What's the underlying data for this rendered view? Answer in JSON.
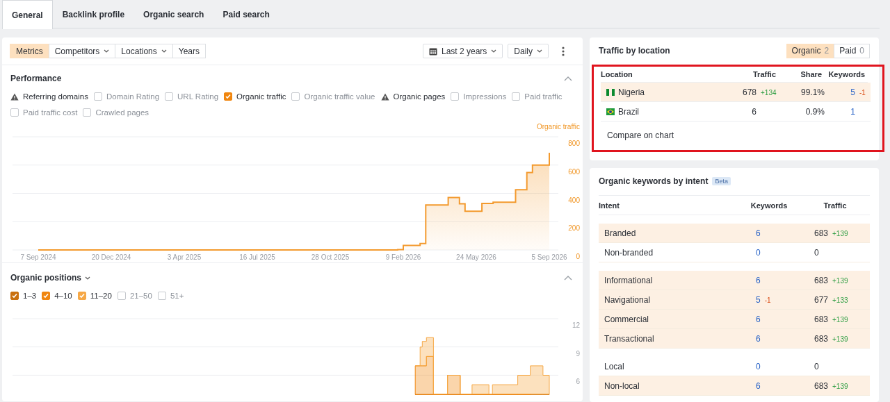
{
  "tabs": [
    {
      "label": "General",
      "selected": true
    },
    {
      "label": "Backlink profile",
      "selected": false
    },
    {
      "label": "Organic search",
      "selected": false
    },
    {
      "label": "Paid search",
      "selected": false
    }
  ],
  "toolbar": {
    "view_buttons": [
      {
        "label": "Metrics",
        "selected": true,
        "dropdown": false
      },
      {
        "label": "Competitors",
        "selected": false,
        "dropdown": true
      },
      {
        "label": "Locations",
        "selected": false,
        "dropdown": true
      },
      {
        "label": "Years",
        "selected": false,
        "dropdown": false
      }
    ],
    "date_range": "Last 2 years",
    "interval": "Daily"
  },
  "performance": {
    "title": "Performance",
    "expanded": true,
    "metrics": [
      {
        "label": "Referring domains",
        "kind": "warning"
      },
      {
        "label": "Domain Rating",
        "kind": "checkbox",
        "checked": false
      },
      {
        "label": "URL Rating",
        "kind": "checkbox",
        "checked": false
      },
      {
        "label": "Organic traffic",
        "kind": "checkbox",
        "checked": true
      },
      {
        "label": "Organic traffic value",
        "kind": "checkbox",
        "checked": false
      },
      {
        "label": "Organic pages",
        "kind": "warning"
      },
      {
        "label": "Impressions",
        "kind": "checkbox",
        "checked": false
      },
      {
        "label": "Paid traffic",
        "kind": "checkbox",
        "checked": false
      },
      {
        "label": "Paid traffic cost",
        "kind": "checkbox",
        "checked": false
      },
      {
        "label": "Crawled pages",
        "kind": "checkbox",
        "checked": false
      }
    ],
    "chart_data": {
      "type": "area",
      "grid": true,
      "ylim": [
        0,
        800
      ],
      "yticks": [
        0,
        200,
        400,
        600,
        800
      ],
      "categories": [
        "7 Sep 2024",
        null,
        null,
        null,
        null,
        null,
        null,
        null,
        null,
        null,
        null,
        null,
        null,
        "20 Dec 2024",
        null,
        null,
        null,
        null,
        null,
        null,
        null,
        null,
        null,
        null,
        null,
        null,
        "3 Apr 2025",
        null,
        null,
        null,
        null,
        null,
        null,
        null,
        null,
        null,
        null,
        null,
        null,
        "16 Jul 2025",
        null,
        null,
        null,
        null,
        null,
        null,
        null,
        null,
        null,
        null,
        null,
        null,
        "28 Oct 2025",
        null,
        null,
        null,
        null,
        null,
        null,
        null,
        null,
        null,
        null,
        null,
        null,
        "9 Feb 2026",
        null,
        null,
        null,
        null,
        null,
        null,
        null,
        null,
        null,
        null,
        null,
        null,
        "24 May 2026",
        null,
        null,
        null,
        null,
        null,
        null,
        null,
        null,
        null,
        null,
        null,
        null,
        "5 Sep 2026"
      ],
      "series": [
        {
          "name": "Organic traffic",
          "color": "#f39a2e",
          "values": [
            0,
            0,
            0,
            0,
            0,
            0,
            0,
            0,
            0,
            0,
            0,
            0,
            0,
            0,
            0,
            0,
            0,
            0,
            0,
            0,
            0,
            0,
            0,
            0,
            0,
            0,
            0,
            0,
            0,
            0,
            0,
            0,
            0,
            0,
            0,
            0,
            0,
            0,
            0,
            0,
            0,
            0,
            0,
            0,
            0,
            0,
            0,
            0,
            0,
            0,
            0,
            0,
            0,
            0,
            0,
            0,
            0,
            0,
            0,
            0,
            0,
            0,
            0,
            0,
            2,
            32,
            32,
            32,
            45,
            318,
            318,
            318,
            318,
            371,
            371,
            326,
            274,
            274,
            274,
            329,
            329,
            337,
            337,
            337,
            337,
            426,
            426,
            547,
            600,
            600,
            600,
            687
          ]
        }
      ]
    }
  },
  "organic_positions": {
    "title": "Organic positions",
    "expanded": true,
    "ranges": [
      {
        "label": "1–3",
        "checked": true,
        "color": "#c9700e"
      },
      {
        "label": "4–10",
        "checked": true,
        "color": "#f0860f"
      },
      {
        "label": "11–20",
        "checked": true,
        "color": "#f6a846"
      },
      {
        "label": "21–50",
        "checked": false
      },
      {
        "label": "51+",
        "checked": false
      }
    ],
    "y_axis_labels": [
      "12",
      "9",
      "6"
    ]
  },
  "traffic_by_location": {
    "title": "Traffic by location",
    "highlighted": true,
    "toggle": [
      {
        "label": "Organic",
        "count": "2",
        "selected": true
      },
      {
        "label": "Paid",
        "count": "0",
        "selected": false
      }
    ],
    "columns": [
      "Location",
      "Traffic",
      "Share",
      "Keywords"
    ],
    "rows": [
      {
        "kind": "nigeria",
        "name": "Nigeria",
        "traffic": "678",
        "traffic_delta": {
          "text": "+134",
          "kind": "increase"
        },
        "share": "99.1%",
        "keywords": "5",
        "keywords_delta": {
          "text": "-1",
          "kind": "decrease"
        },
        "highlighted": true
      },
      {
        "kind": "brazil",
        "name": "Brazil",
        "traffic": "6",
        "share": "0.9%",
        "keywords": "1",
        "highlighted": false
      }
    ],
    "compare_link": "Compare on chart"
  },
  "keywords_by_intent": {
    "title": "Organic keywords by intent",
    "badge": "Beta",
    "columns": [
      "Intent",
      "Keywords",
      "Traffic"
    ],
    "groups": [
      {
        "rows": [
          {
            "label": "Branded",
            "keywords": "6",
            "traffic": "683",
            "traffic_delta": {
              "text": "+139",
              "kind": "increase"
            },
            "highlighted": true
          },
          {
            "label": "Non-branded",
            "keywords": "0",
            "traffic": "0",
            "highlighted": false
          }
        ]
      },
      {
        "rows": [
          {
            "label": "Informational",
            "keywords": "6",
            "traffic": "683",
            "traffic_delta": {
              "text": "+139",
              "kind": "increase"
            },
            "highlighted": true
          },
          {
            "label": "Navigational",
            "keywords": "5",
            "keywords_delta": {
              "text": "-1",
              "kind": "decrease"
            },
            "traffic": "677",
            "traffic_delta": {
              "text": "+133",
              "kind": "increase"
            },
            "highlighted": true
          },
          {
            "label": "Commercial",
            "keywords": "6",
            "traffic": "683",
            "traffic_delta": {
              "text": "+139",
              "kind": "increase"
            },
            "highlighted": true
          },
          {
            "label": "Transactional",
            "keywords": "6",
            "traffic": "683",
            "traffic_delta": {
              "text": "+139",
              "kind": "increase"
            },
            "highlighted": true
          }
        ]
      },
      {
        "rows": [
          {
            "label": "Local",
            "keywords": "0",
            "traffic": "0",
            "highlighted": false
          },
          {
            "label": "Non-local",
            "keywords": "6",
            "traffic": "683",
            "traffic_delta": {
              "text": "+139",
              "kind": "increase"
            },
            "highlighted": true
          }
        ]
      }
    ]
  }
}
